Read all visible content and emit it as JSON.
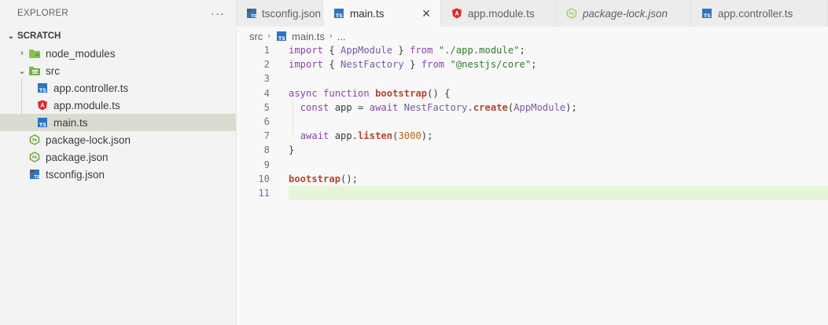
{
  "sidebar": {
    "title": "EXPLORER",
    "more_label": "···",
    "section": "SCRATCH",
    "items": [
      {
        "label": "node_modules",
        "type": "folder",
        "icon": "folder-node-icon"
      },
      {
        "label": "src",
        "type": "folder-open",
        "icon": "folder-src-icon"
      },
      {
        "label": "app.controller.ts",
        "type": "ts",
        "icon": "typescript-icon"
      },
      {
        "label": "app.module.ts",
        "type": "angular",
        "icon": "angular-icon"
      },
      {
        "label": "main.ts",
        "type": "ts",
        "icon": "typescript-icon"
      },
      {
        "label": "package-lock.json",
        "type": "node",
        "icon": "nodejs-icon"
      },
      {
        "label": "package.json",
        "type": "node",
        "icon": "nodejs-icon"
      },
      {
        "label": "tsconfig.json",
        "type": "tsconfig",
        "icon": "tsconfig-icon"
      }
    ]
  },
  "tabs": [
    {
      "label": "tsconfig.json"
    },
    {
      "label": "main.ts",
      "close": "✕"
    },
    {
      "label": "app.module.ts"
    },
    {
      "label": "package-lock.json"
    },
    {
      "label": "app.controller.ts"
    }
  ],
  "breadcrumb": {
    "folder": "src",
    "file": "main.ts",
    "more": "..."
  },
  "editor": {
    "line_numbers": [
      "1",
      "2",
      "3",
      "4",
      "5",
      "6",
      "7",
      "8",
      "9",
      "10",
      "11"
    ],
    "lines": [
      [
        {
          "t": "import",
          "c": "k"
        },
        {
          "t": " { "
        },
        {
          "t": "AppModule",
          "c": "cls"
        },
        {
          "t": " } "
        },
        {
          "t": "from",
          "c": "k"
        },
        {
          "t": " "
        },
        {
          "t": "\"./app.module\"",
          "c": "s"
        },
        {
          "t": ";"
        }
      ],
      [
        {
          "t": "import",
          "c": "k"
        },
        {
          "t": " { "
        },
        {
          "t": "NestFactory",
          "c": "cls"
        },
        {
          "t": " } "
        },
        {
          "t": "from",
          "c": "k"
        },
        {
          "t": " "
        },
        {
          "t": "\"@nestjs/core\"",
          "c": "s"
        },
        {
          "t": ";"
        }
      ],
      [],
      [
        {
          "t": "async",
          "c": "k"
        },
        {
          "t": " "
        },
        {
          "t": "function",
          "c": "k"
        },
        {
          "t": " "
        },
        {
          "t": "bootstrap",
          "c": "fn"
        },
        {
          "t": "() {"
        }
      ],
      [
        {
          "t": "  "
        },
        {
          "t": "const",
          "c": "k"
        },
        {
          "t": " app = "
        },
        {
          "t": "await",
          "c": "k"
        },
        {
          "t": " "
        },
        {
          "t": "NestFactory",
          "c": "cls"
        },
        {
          "t": "."
        },
        {
          "t": "create",
          "c": "fn"
        },
        {
          "t": "("
        },
        {
          "t": "AppModule",
          "c": "cls"
        },
        {
          "t": ");"
        }
      ],
      [],
      [
        {
          "t": "  "
        },
        {
          "t": "await",
          "c": "k"
        },
        {
          "t": " app."
        },
        {
          "t": "listen",
          "c": "fn"
        },
        {
          "t": "("
        },
        {
          "t": "3000",
          "c": "num"
        },
        {
          "t": ");"
        }
      ],
      [
        {
          "t": "}"
        }
      ],
      [],
      [
        {
          "t": "bootstrap",
          "c": "fn"
        },
        {
          "t": "();"
        }
      ],
      []
    ]
  }
}
